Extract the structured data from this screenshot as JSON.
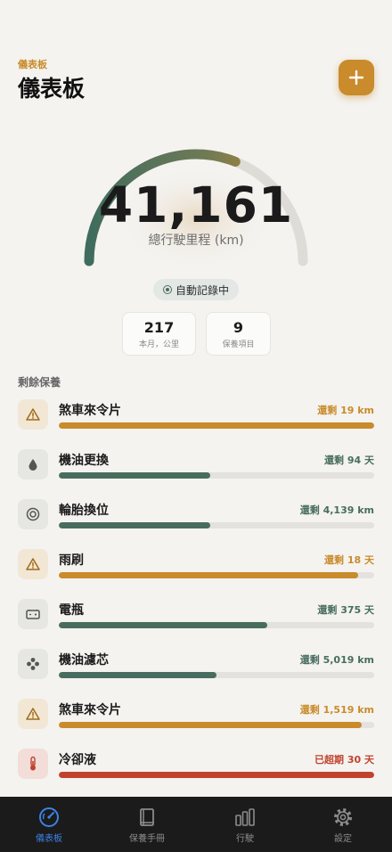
{
  "header": {
    "subtitle": "儀表板",
    "title": "儀表板",
    "add_label": "+"
  },
  "odometer": {
    "value": "41,161",
    "label": "總行駛里程 (km)",
    "gauge_fill": 0.62
  },
  "auto_badge": "自動記錄中",
  "stats": [
    {
      "value": "217",
      "label": "本月，公里"
    },
    {
      "value": "9",
      "label": "保養項目"
    }
  ],
  "section_title": "剩餘保養",
  "colors": {
    "amber": "#c98b2b",
    "green": "#486d5f",
    "red": "#c0432d",
    "track": "#e3e2de"
  },
  "items": [
    {
      "name": "煞車來令片",
      "remain": "還剩 19 km",
      "status": "amber",
      "icon": "warning-icon",
      "progress": 1.0
    },
    {
      "name": "機油更換",
      "remain": "還剩 94 天",
      "status": "green",
      "icon": "oil-drop-icon",
      "progress": 0.48
    },
    {
      "name": "輪胎換位",
      "remain": "還剩 4,139 km",
      "status": "green",
      "icon": "tire-icon",
      "progress": 0.48
    },
    {
      "name": "雨刷",
      "remain": "還剩 18 天",
      "status": "amber",
      "icon": "warning-icon",
      "progress": 0.95
    },
    {
      "name": "電瓶",
      "remain": "還剩 375 天",
      "status": "green",
      "icon": "battery-icon",
      "progress": 0.66
    },
    {
      "name": "機油濾芯",
      "remain": "還剩 5,019 km",
      "status": "green",
      "icon": "filter-icon",
      "progress": 0.5
    },
    {
      "name": "煞車來令片",
      "remain": "還剩 1,519 km",
      "status": "amber",
      "icon": "warning-icon",
      "progress": 0.96
    },
    {
      "name": "冷卻液",
      "remain": "已超期 30 天",
      "status": "red",
      "icon": "thermometer-icon",
      "progress": 1.0
    }
  ],
  "tabs": [
    {
      "label": "儀表板",
      "icon": "speedometer-icon",
      "active": true
    },
    {
      "label": "保養手冊",
      "icon": "book-icon",
      "active": false
    },
    {
      "label": "行駛",
      "icon": "bar-chart-icon",
      "active": false
    },
    {
      "label": "設定",
      "icon": "gear-icon",
      "active": false
    }
  ]
}
